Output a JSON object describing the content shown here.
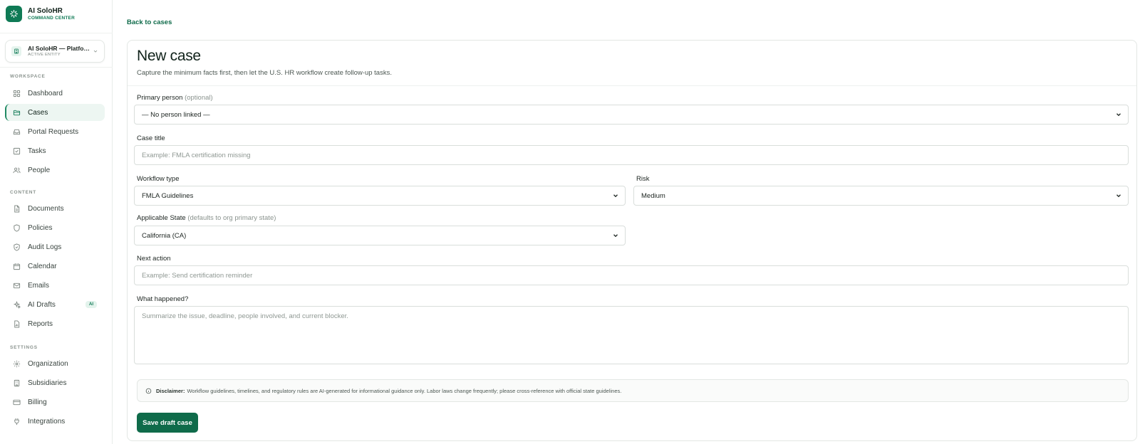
{
  "app": {
    "name": "AI SoloHR",
    "subtitle": "COMMAND CENTER"
  },
  "entity": {
    "name": "AI SoloHR — Platfor...",
    "status": "ACTIVE ENTITY"
  },
  "sidebar": {
    "sections": [
      {
        "label": "WORKSPACE",
        "items": [
          {
            "label": "Dashboard",
            "icon": "grid-icon"
          },
          {
            "label": "Cases",
            "icon": "folder-icon",
            "active": true
          },
          {
            "label": "Portal Requests",
            "icon": "inbox-icon"
          },
          {
            "label": "Tasks",
            "icon": "checkbox-icon"
          },
          {
            "label": "People",
            "icon": "people-icon"
          }
        ]
      },
      {
        "label": "CONTENT",
        "items": [
          {
            "label": "Documents",
            "icon": "document-icon"
          },
          {
            "label": "Policies",
            "icon": "shield-icon"
          },
          {
            "label": "Audit Logs",
            "icon": "shield-check-icon"
          },
          {
            "label": "Calendar",
            "icon": "calendar-icon"
          },
          {
            "label": "Emails",
            "icon": "mail-icon"
          },
          {
            "label": "AI Drafts",
            "icon": "sparkle-icon",
            "badge": "AI"
          },
          {
            "label": "Reports",
            "icon": "report-icon"
          }
        ]
      },
      {
        "label": "SETTINGS",
        "items": [
          {
            "label": "Organization",
            "icon": "gear-icon"
          },
          {
            "label": "Subsidiaries",
            "icon": "building-icon"
          },
          {
            "label": "Billing",
            "icon": "credit-card-icon"
          },
          {
            "label": "Integrations",
            "icon": "plug-icon"
          }
        ]
      }
    ]
  },
  "main": {
    "back_link": "Back to cases",
    "title": "New case",
    "subtitle": "Capture the minimum facts first, then let the U.S. HR workflow create follow-up tasks.",
    "form": {
      "primary_person": {
        "label": "Primary person",
        "hint": "(optional)",
        "value": "— No person linked —"
      },
      "case_title": {
        "label": "Case title",
        "placeholder": "Example: FMLA certification missing"
      },
      "workflow_type": {
        "label": "Workflow type",
        "value": "FMLA Guidelines"
      },
      "risk": {
        "label": "Risk",
        "value": "Medium"
      },
      "applicable_state": {
        "label": "Applicable State",
        "hint": "(defaults to org primary state)",
        "value": "California (CA)"
      },
      "next_action": {
        "label": "Next action",
        "placeholder": "Example: Send certification reminder"
      },
      "what_happened": {
        "label": "What happened?",
        "placeholder": "Summarize the issue, deadline, people involved, and current blocker."
      }
    },
    "disclaimer": {
      "label": "Disclaimer:",
      "text": "Workflow guidelines, timelines, and regulatory rules are AI-generated for informational guidance only. Labor laws change frequently; please cross-reference with official state guidelines."
    },
    "save_label": "Save draft case"
  },
  "colors": {
    "brand": "#0f7a55",
    "primary_button": "#0f6b4a",
    "active_nav_bg": "#edf6f2"
  }
}
